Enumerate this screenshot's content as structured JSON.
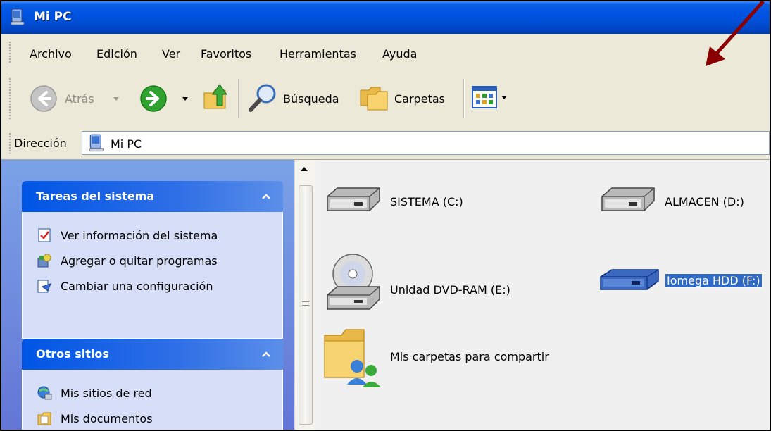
{
  "window": {
    "title": "Mi PC"
  },
  "menu": {
    "items": [
      "Archivo",
      "Edición",
      "Ver",
      "Favoritos",
      "Herramientas",
      "Ayuda"
    ]
  },
  "toolbar": {
    "back_label": "Atrás",
    "search_label": "Búsqueda",
    "folders_label": "Carpetas"
  },
  "address": {
    "label": "Dirección",
    "value": "Mi PC"
  },
  "taskpane": {
    "system_tasks": {
      "title": "Tareas del sistema",
      "items": [
        {
          "label": "Ver información del sistema",
          "icon": "system-info-icon"
        },
        {
          "label": "Agregar o quitar programas",
          "icon": "add-remove-programs-icon"
        },
        {
          "label": "Cambiar una configuración",
          "icon": "control-panel-icon"
        }
      ]
    },
    "other_places": {
      "title": "Otros sitios",
      "items": [
        {
          "label": "Mis sitios de red",
          "icon": "network-places-icon"
        },
        {
          "label": "Mis documentos",
          "icon": "my-documents-icon"
        }
      ]
    }
  },
  "drives": [
    {
      "label": "SISTEMA (C:)",
      "icon": "hard-drive-icon",
      "selected": false
    },
    {
      "label": "ALMACEN (D:)",
      "icon": "hard-drive-icon",
      "selected": false
    },
    {
      "label": "Unidad DVD-RAM (E:)",
      "icon": "dvd-drive-icon",
      "selected": false
    },
    {
      "label": "Iomega HDD (F:)",
      "icon": "external-drive-icon",
      "selected": true
    },
    {
      "label": "Mis carpetas para compartir",
      "icon": "shared-folders-icon",
      "selected": false
    }
  ],
  "colors": {
    "titlebar": "#0054e3",
    "selection": "#316ac5",
    "annotation_arrow": "#8b0000"
  }
}
